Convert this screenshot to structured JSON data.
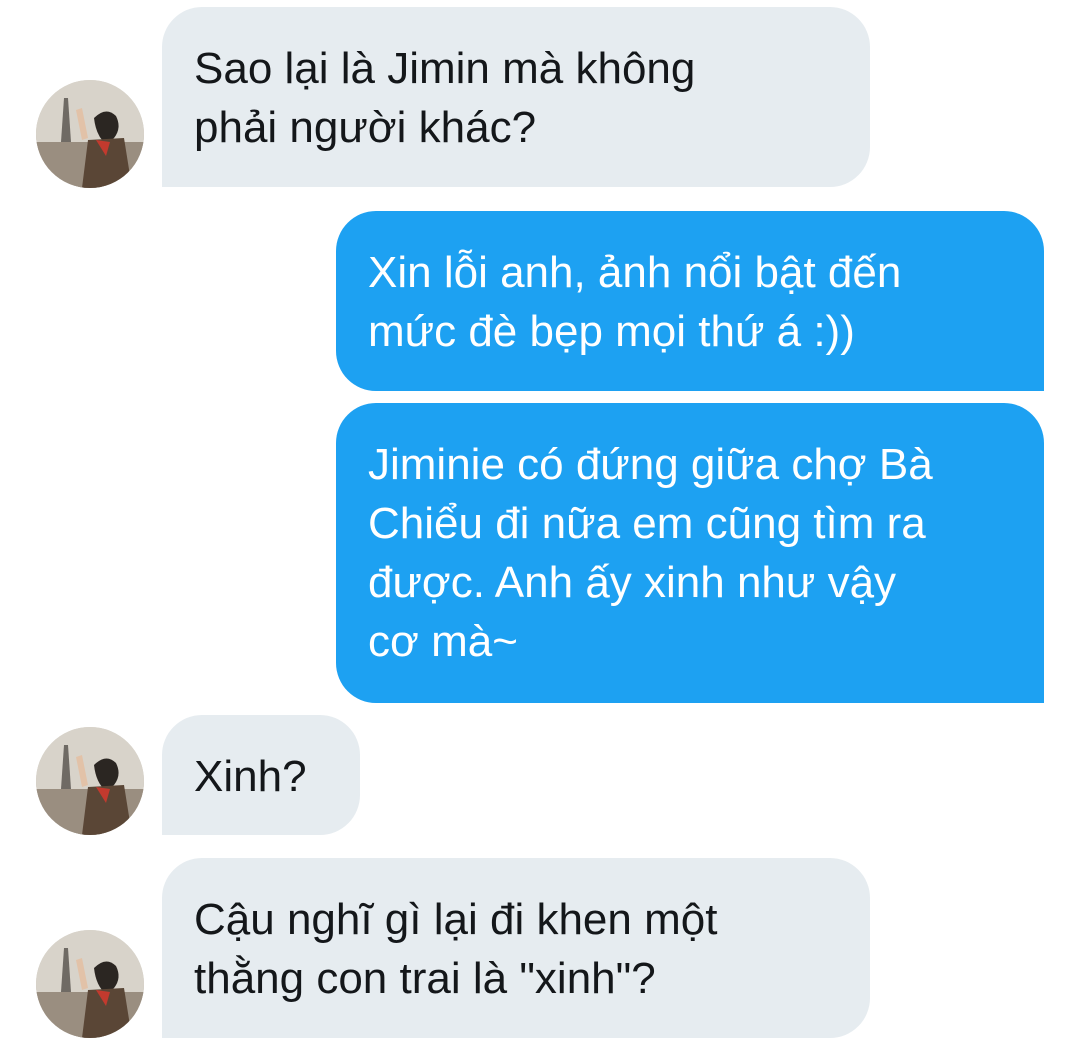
{
  "messages": [
    {
      "side": "incoming",
      "has_avatar": true,
      "text": "Sao lại là Jimin mà không\nphải người khác?"
    },
    {
      "side": "outgoing",
      "has_avatar": false,
      "text": "Xin lỗi anh, ảnh nổi bật đến\nmức đè bẹp mọi thứ á :))"
    },
    {
      "side": "outgoing",
      "has_avatar": false,
      "text": "Jiminie có đứng giữa chợ Bà\nChiểu đi nữa em cũng tìm ra\nđược. Anh ấy xinh như vậy\ncơ mà~"
    },
    {
      "side": "incoming",
      "has_avatar": true,
      "text": "Xinh?"
    },
    {
      "side": "incoming",
      "has_avatar": true,
      "text": "Cậu nghĩ gì lại đi khen một\nthằng con trai là \"xinh\"?"
    }
  ],
  "colors": {
    "incoming_bubble": "#e6ecf0",
    "incoming_text": "#14171a",
    "outgoing_bubble": "#1da1f2",
    "outgoing_text": "#ffffff",
    "background": "#ffffff"
  },
  "icons": {
    "avatar": "profile-photo-avatar"
  }
}
